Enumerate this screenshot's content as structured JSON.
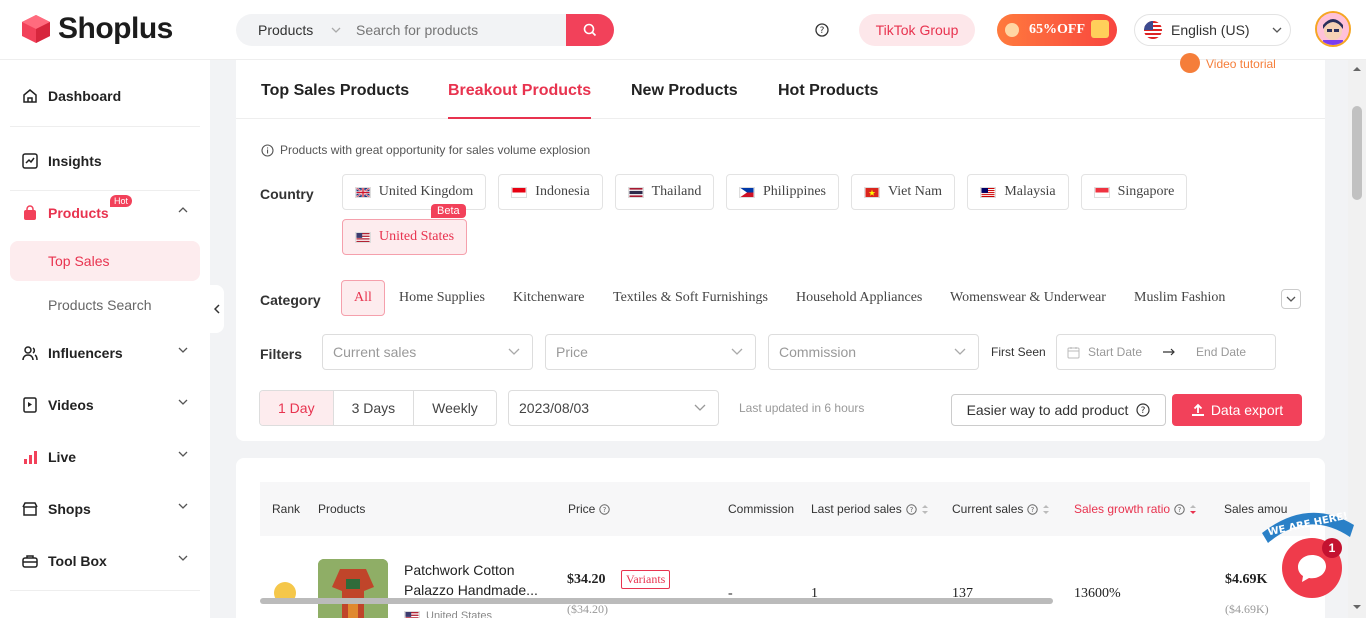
{
  "header": {
    "brand": "Shoplus",
    "search_scope": "Products",
    "search_placeholder": "Search for products",
    "tiktok_group": "TikTok Group",
    "promo": "65%OFF",
    "language": "English (US)"
  },
  "sidebar": {
    "dashboard": "Dashboard",
    "insights": "Insights",
    "products": "Products",
    "hot_badge": "Hot",
    "top_sales": "Top Sales",
    "products_search": "Products Search",
    "influencers": "Influencers",
    "videos": "Videos",
    "live": "Live",
    "shops": "Shops",
    "toolbox": "Tool Box"
  },
  "tabs": [
    "Top Sales Products",
    "Breakout Products",
    "New Products",
    "Hot Products"
  ],
  "video_tutorial": "Video tutorial",
  "tip": "Products with great opportunity for sales volume explosion",
  "country": {
    "label": "Country",
    "items": [
      "United Kingdom",
      "Indonesia",
      "Thailand",
      "Philippines",
      "Viet Nam",
      "Malaysia",
      "Singapore",
      "United States"
    ],
    "beta": "Beta"
  },
  "category": {
    "label": "Category",
    "items": [
      "All",
      "Home Supplies",
      "Kitchenware",
      "Textiles & Soft Furnishings",
      "Household Appliances",
      "Womenswear & Underwear",
      "Muslim Fashion"
    ]
  },
  "filters": {
    "label": "Filters",
    "current_sales": "Current sales",
    "price": "Price",
    "commission": "Commission",
    "first_seen": "First Seen",
    "start_date": "Start Date",
    "end_date": "End Date"
  },
  "period": {
    "day": "1 Day",
    "three_days": "3 Days",
    "weekly": "Weekly",
    "date": "2023/08/03"
  },
  "updated": "Last updated in 6 hours",
  "easy_add": "Easier way to add product",
  "export": "Data export",
  "table": {
    "headers": {
      "rank": "Rank",
      "products": "Products",
      "price": "Price",
      "commission": "Commission",
      "last_sales": "Last period sales",
      "current_sales": "Current sales",
      "growth": "Sales growth ratio",
      "amount": "Sales amou"
    },
    "rows": [
      {
        "rank": "1",
        "name": "Patchwork Cotton Palazzo Handmade...",
        "country": "United States",
        "price": "$34.20",
        "price_usd": "($34.20)",
        "variants": "Variants",
        "commission": "-",
        "last_sales": "1",
        "current_sales": "137",
        "growth": "13600%",
        "amount": "$4.69K",
        "amount_usd": "($4.69K)"
      }
    ]
  },
  "chat": {
    "banner": "WE ARE HERE!",
    "badge": "1"
  },
  "colors": {
    "accent": "#f2415a",
    "accent_light": "#fdecee"
  }
}
